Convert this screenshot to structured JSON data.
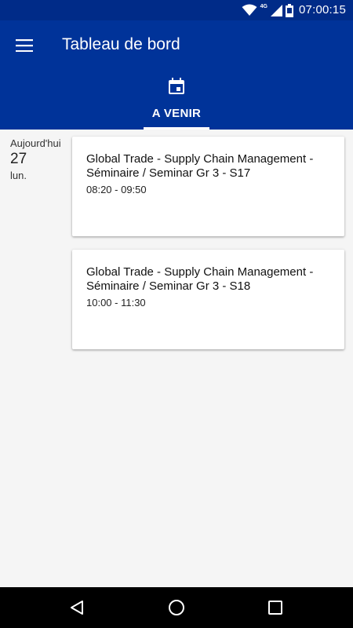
{
  "status_bar": {
    "network": "4G",
    "time": "07:00:15",
    "icons": [
      "wifi-icon",
      "signal-icon",
      "battery-icon"
    ]
  },
  "app_bar": {
    "title": "Tableau de bord",
    "menu_icon": "menu-icon",
    "tabs": [
      {
        "label": "A VENIR",
        "icon": "calendar-icon",
        "selected": true
      }
    ]
  },
  "schedule": {
    "day": {
      "relative": "Aujourd'hui",
      "number": "27",
      "weekday": "lun."
    },
    "events": [
      {
        "title": "Global Trade - Supply Chain Management - Séminaire / Seminar Gr 3 - S17",
        "time": "08:20 - 09:50"
      },
      {
        "title": "Global Trade - Supply Chain Management - Séminaire / Seminar Gr 3 - S18",
        "time": "10:00 - 11:30"
      }
    ]
  },
  "nav_bar": {
    "buttons": [
      "back-icon",
      "home-icon",
      "recent-apps-icon"
    ]
  },
  "colors": {
    "primary": "#003399",
    "status_bar": "#002b88",
    "background": "#f5f5f5",
    "card": "#ffffff"
  }
}
